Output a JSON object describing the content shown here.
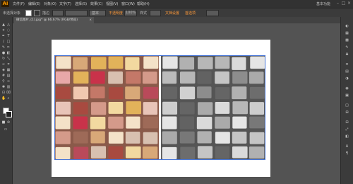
{
  "app": {
    "logo": "Ai"
  },
  "menubar": {
    "items": [
      "文件(F)",
      "编辑(E)",
      "对象(O)",
      "文字(T)",
      "选择(S)",
      "效果(C)",
      "视图(V)",
      "窗口(W)",
      "帮助(H)"
    ],
    "workspace": "基本功能"
  },
  "controlbar": {
    "label1": "未选择对象",
    "stroke_label": "描边",
    "style_label": "基本",
    "opacity_label": "不透明度",
    "opacity_value": "100%",
    "style2_label": "样式",
    "doc_setup": "文档设置",
    "preferences": "首选项"
  },
  "document": {
    "tab_title": "微信图片_(1).jpg* @ 66.67% (RGB/预览)",
    "close": "×"
  },
  "colors": {
    "accent": "#ff9a00",
    "selection": "#4a78d8",
    "canvas": "#535353",
    "panel": "#3b3b3b"
  }
}
